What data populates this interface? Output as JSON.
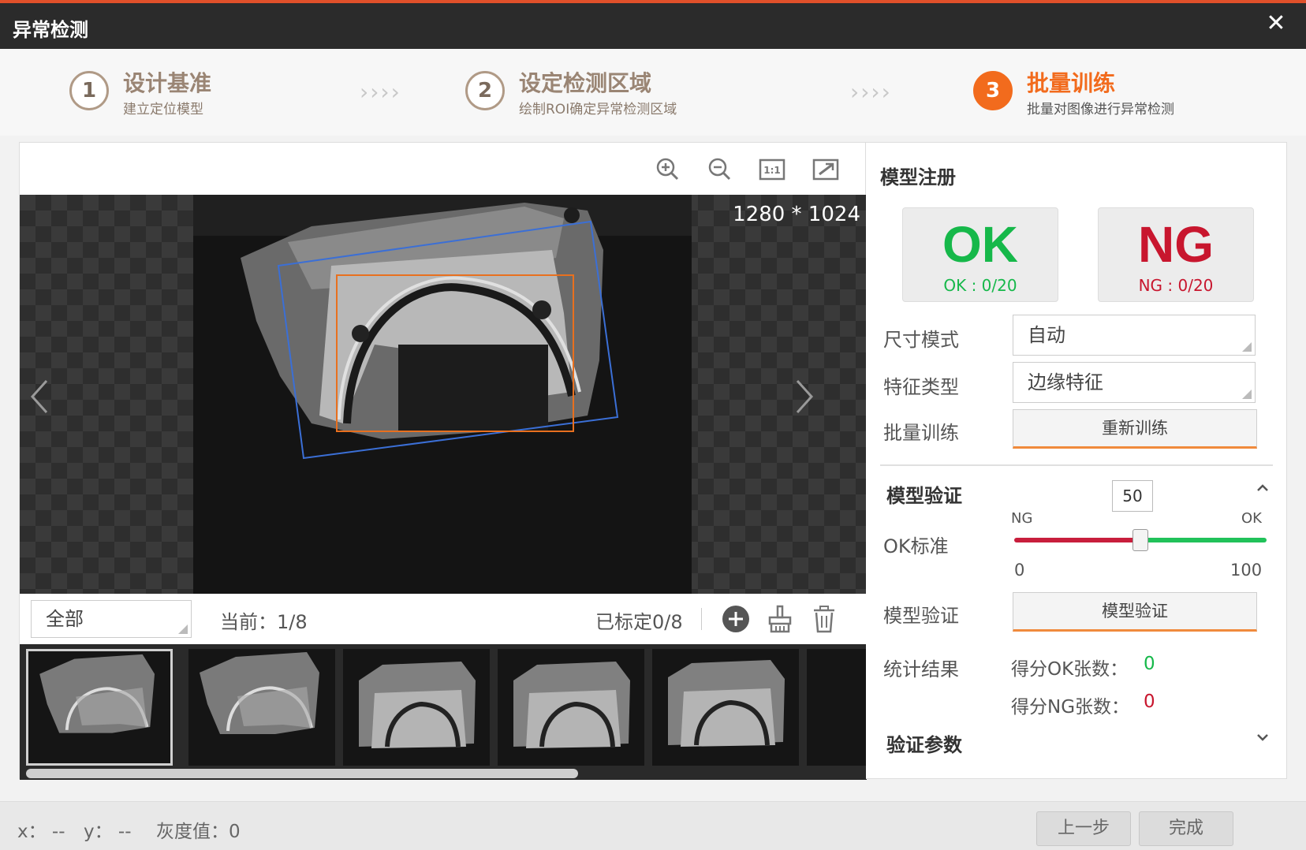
{
  "window": {
    "title": "异常检测",
    "close_glyph": "✕"
  },
  "steps": [
    {
      "num": "1",
      "name": "设计基准",
      "sub": "建立定位模型",
      "active": false
    },
    {
      "num": "2",
      "name": "设定检测区域",
      "sub": "绘制ROI确定异常检测区域",
      "active": false
    },
    {
      "num": "3",
      "name": "批量训练",
      "sub": "批量对图像进行异常检测",
      "active": true
    }
  ],
  "step_separator": "››››",
  "viewer": {
    "toolbar": [
      "zoom-in-icon",
      "zoom-out-icon",
      "actual-size-icon",
      "fit-window-icon"
    ],
    "actual_size_label": "1:1",
    "resolution": "1280 * 1024",
    "filter": {
      "selected": "全部"
    },
    "current": "当前：1/8",
    "marked": "已标定0/8",
    "thumbnails_visible": 5,
    "selected_thumbnail": 1
  },
  "model_register": {
    "title": "模型注册",
    "ok": {
      "big": "OK",
      "count": "OK : 0/20",
      "color": "#16b84a"
    },
    "ng": {
      "big": "NG",
      "count": "NG : 0/20",
      "color": "#c8162e"
    },
    "size_mode": {
      "label": "尺寸模式",
      "value": "自动"
    },
    "feature_type": {
      "label": "特征类型",
      "value": "边缘特征"
    },
    "batch_train": {
      "label": "批量训练",
      "button": "重新训练"
    }
  },
  "model_verify": {
    "title": "模型验证",
    "ok_standard": {
      "label": "OK标准",
      "value": "50",
      "min": "0",
      "max": "100",
      "left_tag": "NG",
      "right_tag": "OK",
      "level": 0.5
    },
    "verify": {
      "label": "模型验证",
      "button": "模型验证"
    },
    "stats": {
      "label": "统计结果",
      "ok_label": "得分OK张数：",
      "ok_value": "0",
      "ng_label": "得分NG张数：",
      "ng_value": "0"
    }
  },
  "verify_params": {
    "title": "验证参数"
  },
  "status": {
    "x": "x：  --",
    "y": "y：  --",
    "gray": "灰度值：0"
  },
  "footer": {
    "prev": "上一步",
    "done": "完成"
  },
  "colors": {
    "accent": "#f26b1d",
    "roi_blue": "#3b6fd6",
    "roi_orange": "#e8701f",
    "ok_green": "#16b84a",
    "ng_red": "#c8162e"
  }
}
